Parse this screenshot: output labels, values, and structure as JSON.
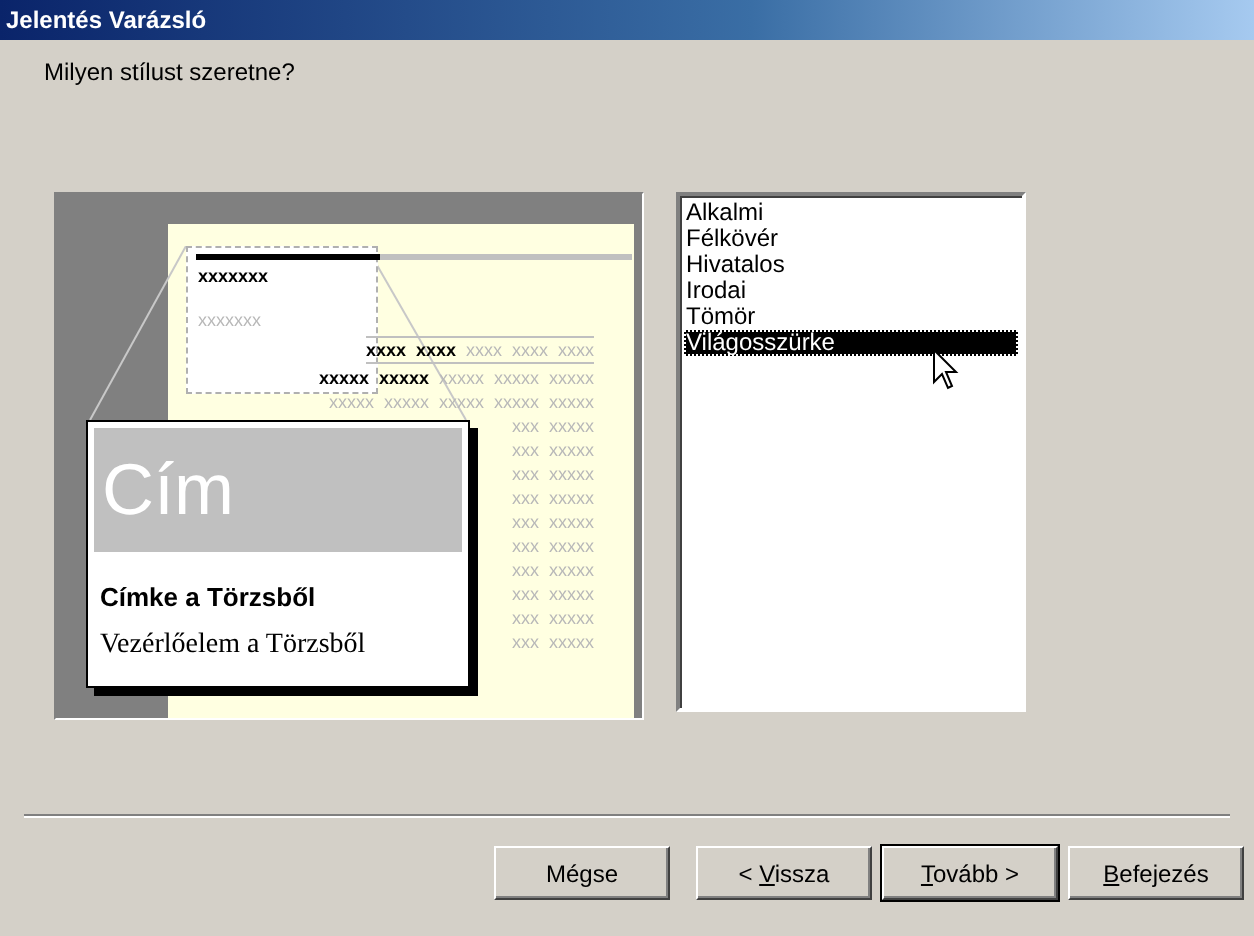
{
  "window": {
    "title": "Jelentés Varázsló"
  },
  "prompt": "Milyen stílust szeretne?",
  "preview": {
    "heading_mark": "xxxxxxx",
    "subheading_mark": "xxxxxxx",
    "header_cells": [
      {
        "text": "xxxx",
        "dark": true
      },
      {
        "text": "xxxx",
        "dark": true
      },
      {
        "text": "xxxx",
        "dark": false
      },
      {
        "text": "xxxx",
        "dark": false
      },
      {
        "text": "xxxx",
        "dark": false
      }
    ],
    "rows": [
      {
        "cells": [
          {
            "text": "xxxxx",
            "dark": true
          },
          {
            "text": "xxxxx",
            "dark": true
          },
          {
            "text": "xxxxx",
            "dark": false
          },
          {
            "text": "xxxxx",
            "dark": false
          },
          {
            "text": "xxxxx",
            "dark": false
          }
        ]
      },
      {
        "cells": [
          {
            "text": "xxxxx",
            "dark": false
          },
          {
            "text": "xxxxx",
            "dark": false
          },
          {
            "text": "xxxxx",
            "dark": false
          },
          {
            "text": "xxxxx",
            "dark": false
          },
          {
            "text": "xxxxx",
            "dark": false
          }
        ]
      },
      {
        "cells": [
          {
            "text": "xxx",
            "dark": false
          },
          {
            "text": "xxxxx",
            "dark": false
          }
        ]
      },
      {
        "cells": [
          {
            "text": "xxx",
            "dark": false
          },
          {
            "text": "xxxxx",
            "dark": false
          }
        ]
      },
      {
        "cells": [
          {
            "text": "xxx",
            "dark": false
          },
          {
            "text": "xxxxx",
            "dark": false
          }
        ]
      },
      {
        "cells": [
          {
            "text": "xxx",
            "dark": false
          },
          {
            "text": "xxxxx",
            "dark": false
          }
        ]
      },
      {
        "cells": [
          {
            "text": "xxx",
            "dark": false
          },
          {
            "text": "xxxxx",
            "dark": false
          }
        ]
      },
      {
        "cells": [
          {
            "text": "xxx",
            "dark": false
          },
          {
            "text": "xxxxx",
            "dark": false
          }
        ]
      },
      {
        "cells": [
          {
            "text": "xxx",
            "dark": false
          },
          {
            "text": "xxxxx",
            "dark": false
          }
        ]
      },
      {
        "cells": [
          {
            "text": "xxx",
            "dark": false
          },
          {
            "text": "xxxxx",
            "dark": false
          }
        ]
      },
      {
        "cells": [
          {
            "text": "xxx",
            "dark": false
          },
          {
            "text": "xxxxx",
            "dark": false
          }
        ]
      },
      {
        "cells": [
          {
            "text": "xxx",
            "dark": false
          },
          {
            "text": "xxxxx",
            "dark": false
          }
        ]
      }
    ],
    "popup": {
      "title": "Cím",
      "label": "Címke a Törzsből",
      "control": "Vezérlőelem a Törzsből"
    }
  },
  "styles": [
    {
      "label": "Alkalmi",
      "selected": false
    },
    {
      "label": "Félkövér",
      "selected": false
    },
    {
      "label": "Hivatalos",
      "selected": false
    },
    {
      "label": "Irodai",
      "selected": false
    },
    {
      "label": "Tömör",
      "selected": false
    },
    {
      "label": "Világosszürke",
      "selected": true
    }
  ],
  "buttons": [
    {
      "after": "Mégse",
      "default": false
    },
    {
      "before": "< ",
      "key": "V",
      "after": "issza",
      "default": false
    },
    {
      "key": "T",
      "after": "ovább >",
      "default": true
    },
    {
      "key": "B",
      "after": "efejezés",
      "default": false
    }
  ]
}
